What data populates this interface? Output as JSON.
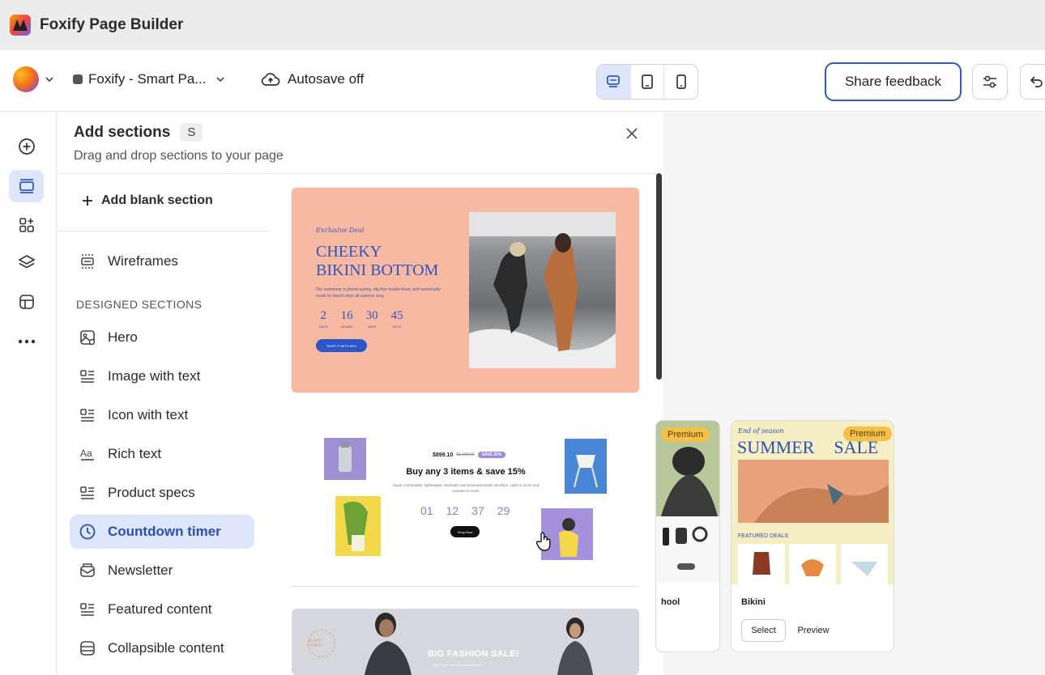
{
  "app": {
    "title": "Foxify Page Builder"
  },
  "toolbar": {
    "store_name": "Foxify - Smart Pa...",
    "autosave_label": "Autosave off",
    "share_feedback_label": "Share feedback",
    "devices": [
      "desktop-icon",
      "tablet-icon",
      "mobile-icon"
    ],
    "active_device": "desktop"
  },
  "panel": {
    "title": "Add sections",
    "shortcut": "S",
    "subtitle": "Drag and drop sections to your page",
    "add_blank_label": "Add blank section",
    "wireframes_label": "Wireframes",
    "designed_heading": "DESIGNED SECTIONS",
    "items": [
      {
        "label": "Hero",
        "icon": "hero-icon"
      },
      {
        "label": "Image with text",
        "icon": "image-text-icon"
      },
      {
        "label": "Icon with text",
        "icon": "icon-text-icon"
      },
      {
        "label": "Rich text",
        "icon": "rich-text-icon"
      },
      {
        "label": "Product specs",
        "icon": "product-specs-icon"
      },
      {
        "label": "Countdown timer",
        "icon": "clock-icon",
        "active": true
      },
      {
        "label": "Newsletter",
        "icon": "newsletter-icon"
      },
      {
        "label": "Featured content",
        "icon": "featured-content-icon"
      },
      {
        "label": "Collapsible content",
        "icon": "collapsible-icon"
      }
    ]
  },
  "previews": {
    "p1": {
      "eyebrow": "Exclusive Deal",
      "title_line1": "CHEEKY",
      "title_line2": "BIKINI BOTTOM",
      "body": "Our swimwear is planet-saving, dig-free double-lined, and sustainably made for beach days all summer long.",
      "timer": [
        {
          "value": "2",
          "unit": "DAYS"
        },
        {
          "value": "16",
          "unit": "HOURS"
        },
        {
          "value": "30",
          "unit": "MINS"
        },
        {
          "value": "45",
          "unit": "SECS"
        }
      ],
      "button": "SHOP IT WITH 50%"
    },
    "p2": {
      "price": "$899.10",
      "old_price": "$1,099.00",
      "tag": "SAVE 20%",
      "title": "Buy any 3 items & save 15%",
      "body": "Super comfortable, lightweight, stackable and environmentally sensitive. Light to move and compact to store.",
      "timer": [
        "01",
        "12",
        "37",
        "29"
      ],
      "button": "Shop Now"
    },
    "p3": {
      "title": "BIG FASHION SALE!",
      "sub": "Buy 2 get 1 free on selected items",
      "stamp": "BLACK FRIDAY"
    }
  },
  "templates": {
    "left": {
      "badge": "Premium",
      "name": "hool"
    },
    "right": {
      "badge": "Premium",
      "eyebrow": "End of season",
      "headline_a": "SUMMER",
      "headline_b": "SALE",
      "deals_label": "FEATURED DEALS",
      "name": "Bikini",
      "select_label": "Select",
      "preview_label": "Preview"
    }
  },
  "colors": {
    "accent": "#2d5bbf",
    "active_bg": "#dde6fb",
    "preview1_bg": "#f7b9a2",
    "timer_purple": "#8a7fd6",
    "premium": "#f3c048"
  }
}
